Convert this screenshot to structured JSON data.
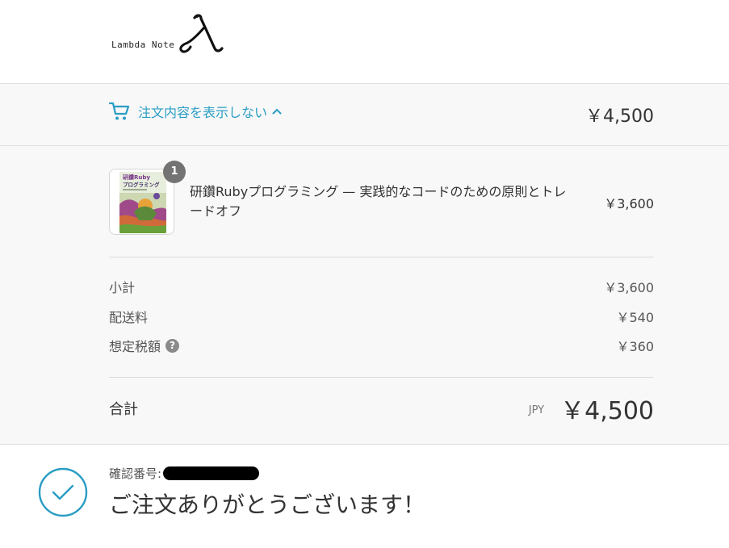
{
  "header": {
    "logo_text": "Lambda Note"
  },
  "summary": {
    "toggle_label": "注文内容を表示しない",
    "toggle_total": "￥4,500",
    "product": {
      "quantity": "1",
      "name": "研鑽Rubyプログラミング — 実践的なコードのための原則とトレードオフ",
      "price": "￥3,600",
      "cover_title_line1": "研鑽Ruby",
      "cover_title_line2": "プログラミング"
    },
    "costs": {
      "subtotal_label": "小計",
      "subtotal_value": "￥3,600",
      "shipping_label": "配送料",
      "shipping_value": "￥540",
      "tax_label": "想定税額",
      "tax_help": "?",
      "tax_value": "￥360"
    },
    "total": {
      "label": "合計",
      "currency": "JPY",
      "value": "￥4,500"
    }
  },
  "confirmation": {
    "number_label": "確認番号:",
    "thanks": "ご注文ありがとうございます！"
  },
  "colors": {
    "accent": "#2a9dc4",
    "summary_bg": "#f8f8f8",
    "badge": "#737373"
  },
  "icons": {
    "cart": "cart-icon",
    "chevron": "chevron-up-icon",
    "check": "check-circle-icon",
    "help": "question-circle-icon"
  }
}
